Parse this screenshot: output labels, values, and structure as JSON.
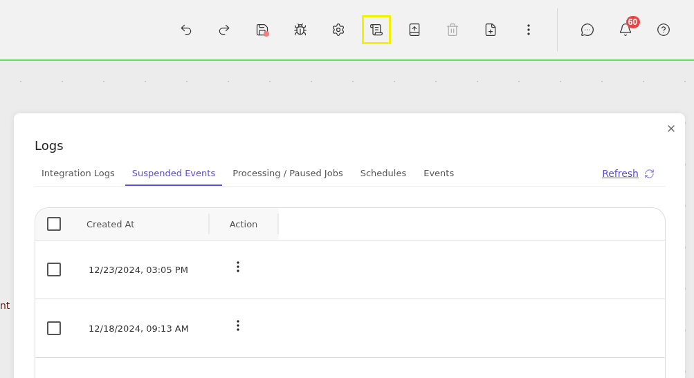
{
  "toolbar": {
    "actions": [
      {
        "selected": false,
        "disabled": false,
        "unsaved": false
      },
      {
        "selected": false,
        "disabled": false,
        "unsaved": false
      },
      {
        "selected": false,
        "disabled": false,
        "unsaved": true
      },
      {
        "selected": false,
        "disabled": false,
        "unsaved": false
      },
      {
        "selected": false,
        "disabled": false,
        "unsaved": false
      },
      {
        "selected": true,
        "disabled": false,
        "unsaved": false
      },
      {
        "selected": false,
        "disabled": false,
        "unsaved": false
      },
      {
        "selected": false,
        "disabled": true,
        "unsaved": false
      },
      {
        "selected": false,
        "disabled": false,
        "unsaved": false
      },
      {
        "selected": false,
        "disabled": false,
        "unsaved": false
      }
    ],
    "notifications_badge": "60"
  },
  "canvas_fragment": "nt",
  "dialog": {
    "title": "Logs",
    "tabs": [
      {
        "label": "Integration Logs",
        "selected": false
      },
      {
        "label": "Suspended Events",
        "selected": true
      },
      {
        "label": "Processing / Paused Jobs",
        "selected": false
      },
      {
        "label": "Schedules",
        "selected": false
      },
      {
        "label": "Events",
        "selected": false
      }
    ],
    "refresh": "Refresh",
    "table": {
      "columns": [
        "Created At",
        "Action"
      ],
      "header_checked": false,
      "rows": [
        {
          "created_at": "12/23/2024, 03:05 PM",
          "checked": false
        },
        {
          "created_at": "12/18/2024, 09:13 AM",
          "checked": false
        }
      ]
    }
  }
}
